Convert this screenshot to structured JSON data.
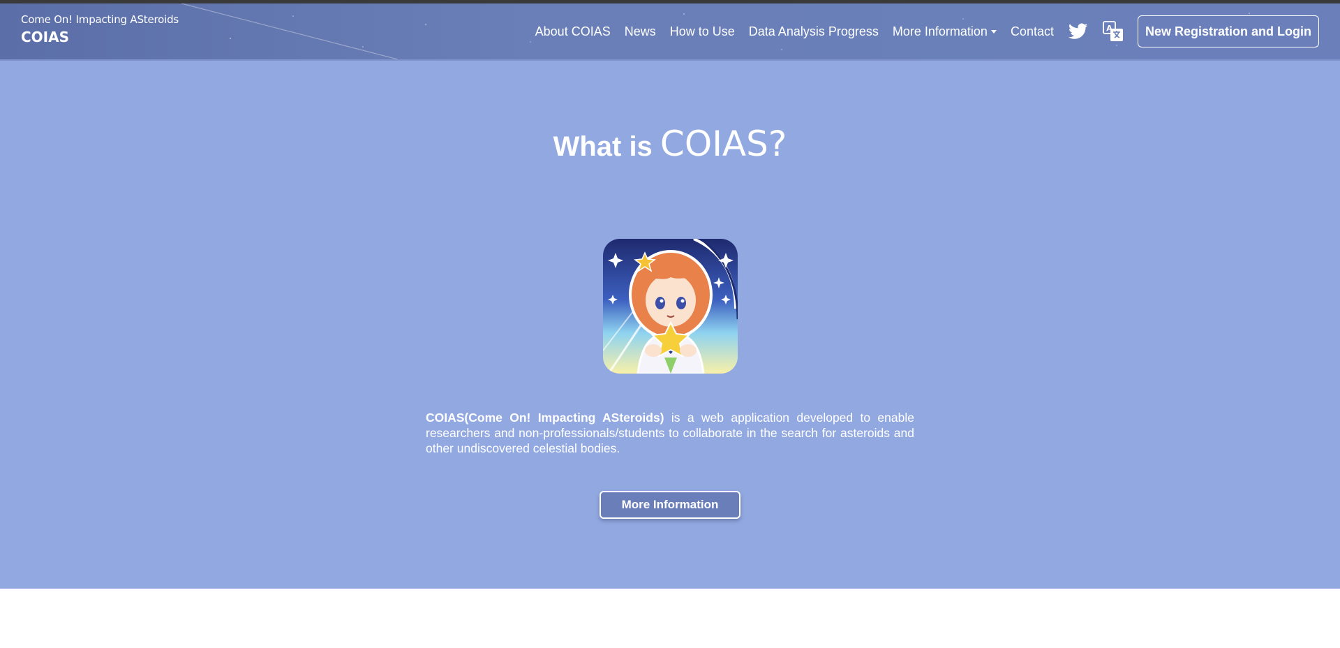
{
  "brand": {
    "subtitle": "Come On! Impacting ASteroids",
    "name": "COIAS"
  },
  "nav": {
    "items": [
      {
        "label": "About COIAS"
      },
      {
        "label": "News"
      },
      {
        "label": "How to Use"
      },
      {
        "label": "Data Analysis Progress"
      },
      {
        "label": "More Information",
        "dropdown": true
      },
      {
        "label": "Contact"
      }
    ],
    "icons": [
      "twitter-icon",
      "translate-icon"
    ],
    "login_label": "New Registration and Login"
  },
  "hero": {
    "title_prefix": "What is ",
    "title_main": "COIAS?",
    "description_bold": "COIAS(Come On! Impacting ASteroids)",
    "description_rest": " is a web application developed to enable researchers and non-professionals/students to collaborate in the search for asteroids and other undiscovered celestial bodies.",
    "button_label": "More Information"
  },
  "colors": {
    "navbar": "#6a7fb8",
    "hero_background": "#92a8e0",
    "button_background": "#6a7fba",
    "text": "#ffffff"
  }
}
